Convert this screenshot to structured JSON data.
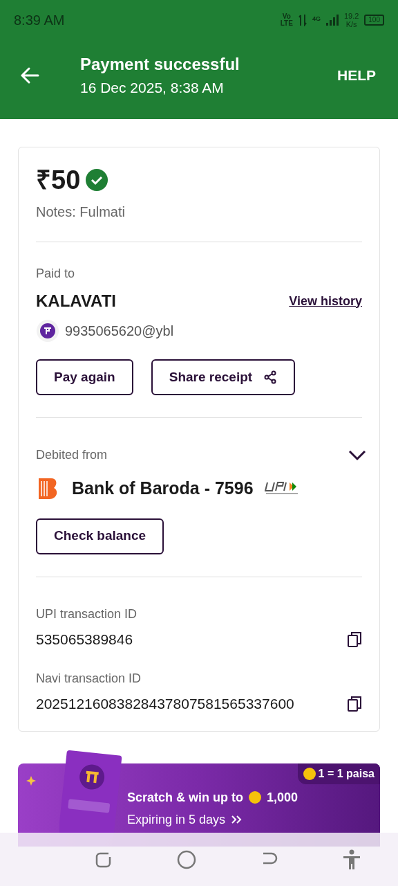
{
  "status_bar": {
    "time": "8:39 AM",
    "network": [
      "Vo",
      "LTE"
    ],
    "generation": "4G",
    "speed": [
      "19.2",
      "K/s"
    ],
    "battery": "100"
  },
  "header": {
    "title": "Payment successful",
    "subtitle": "16 Dec 2025, 8:38 AM",
    "help": "HELP"
  },
  "summary": {
    "amount": "₹50",
    "verified": true,
    "notes": "Notes: Fulmati"
  },
  "paid_to": {
    "label": "Paid to",
    "name": "KALAVATI",
    "link": "View history",
    "upi_id": "9935065620@ybl"
  },
  "actions": [
    {
      "label": "Pay again",
      "kind": "plain"
    },
    {
      "label": "Share receipt",
      "kind": "share"
    }
  ],
  "debited": {
    "label": "Debited from",
    "expanded": false,
    "bank": "Bank of Baroda - 7596",
    "button": "Check balance"
  },
  "transactions": [
    {
      "label": "UPI transaction ID",
      "value": "535065389846"
    },
    {
      "label": "Navi transaction ID",
      "value": "20251216083828437807581565337600"
    }
  ],
  "banner": {
    "badge": "1 = 1 paisa",
    "title": "Scratch & win up to",
    "reward": "1,000",
    "expiry": "Expiring in 5 days"
  }
}
